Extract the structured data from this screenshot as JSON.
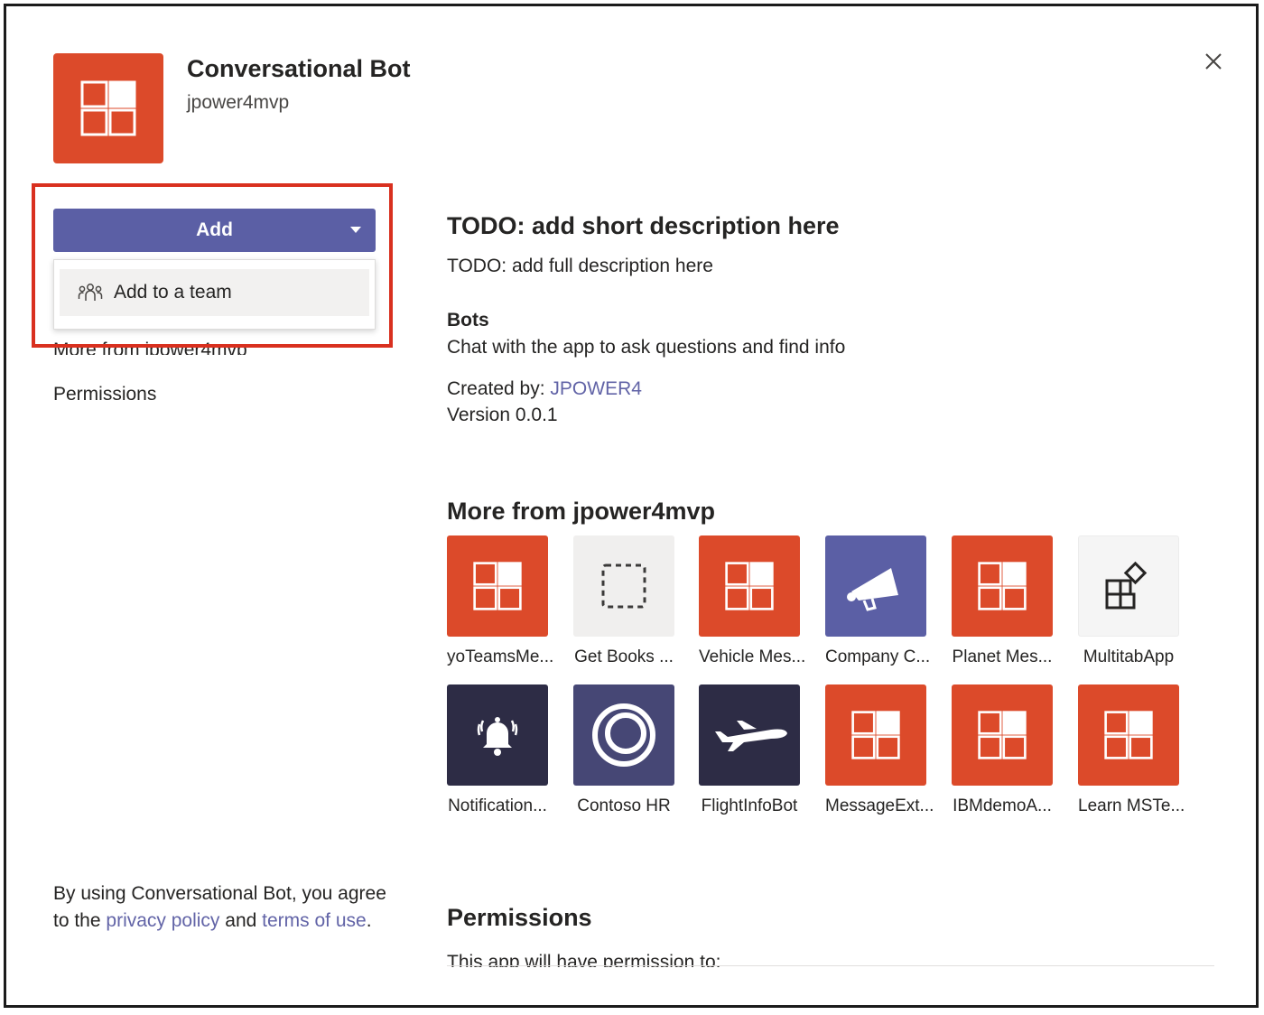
{
  "header": {
    "app_name": "Conversational Bot",
    "publisher": "jpower4mvp",
    "close_icon": "close-icon"
  },
  "left": {
    "add_label": "Add",
    "dropdown_items": [
      {
        "label": "Add to a team",
        "icon": "team-icon"
      }
    ],
    "more_from_link": "More from jpower4mvp",
    "permissions_link": "Permissions",
    "legal": {
      "prefix": "By using Conversational Bot, you agree to the ",
      "privacy": "privacy policy",
      "middle": " and ",
      "terms": "terms of use",
      "suffix": "."
    }
  },
  "details": {
    "short_description": "TODO: add short description here",
    "full_description": "TODO: add full description here",
    "bots_heading": "Bots",
    "bots_description": "Chat with the app to ask questions and find info",
    "created_by_label": "Created by: ",
    "created_by_value": "JPOWER4",
    "version": "Version 0.0.1"
  },
  "more_from": {
    "heading": "More from jpower4mvp",
    "apps": [
      {
        "name": "yoTeamsMe...",
        "icon": "app-grid-icon",
        "color": "#dc4a2a"
      },
      {
        "name": "Get Books ...",
        "icon": "dashed-square-icon",
        "color": "#f0efee"
      },
      {
        "name": "Vehicle Mes...",
        "icon": "app-grid-icon",
        "color": "#dc4a2a"
      },
      {
        "name": "Company C...",
        "icon": "megaphone-icon",
        "color": "#5b5fa5"
      },
      {
        "name": "Planet Mes...",
        "icon": "app-grid-icon",
        "color": "#dc4a2a"
      },
      {
        "name": "MultitabApp",
        "icon": "apps-add-icon",
        "color": "#f5f5f5"
      },
      {
        "name": "Notification...",
        "icon": "bell-icon",
        "color": "#2d2c45"
      },
      {
        "name": "Contoso HR",
        "icon": "ring-icon",
        "color": "#464775"
      },
      {
        "name": "FlightInfoBot",
        "icon": "airplane-icon",
        "color": "#2d2c45"
      },
      {
        "name": "MessageExt...",
        "icon": "app-grid-icon",
        "color": "#dc4a2a"
      },
      {
        "name": "IBMdemoA...",
        "icon": "app-grid-icon",
        "color": "#dc4a2a"
      },
      {
        "name": "Learn MSTe...",
        "icon": "app-grid-icon",
        "color": "#dc4a2a"
      }
    ]
  },
  "permissions": {
    "heading": "Permissions",
    "text": "This app will have permission to:"
  }
}
